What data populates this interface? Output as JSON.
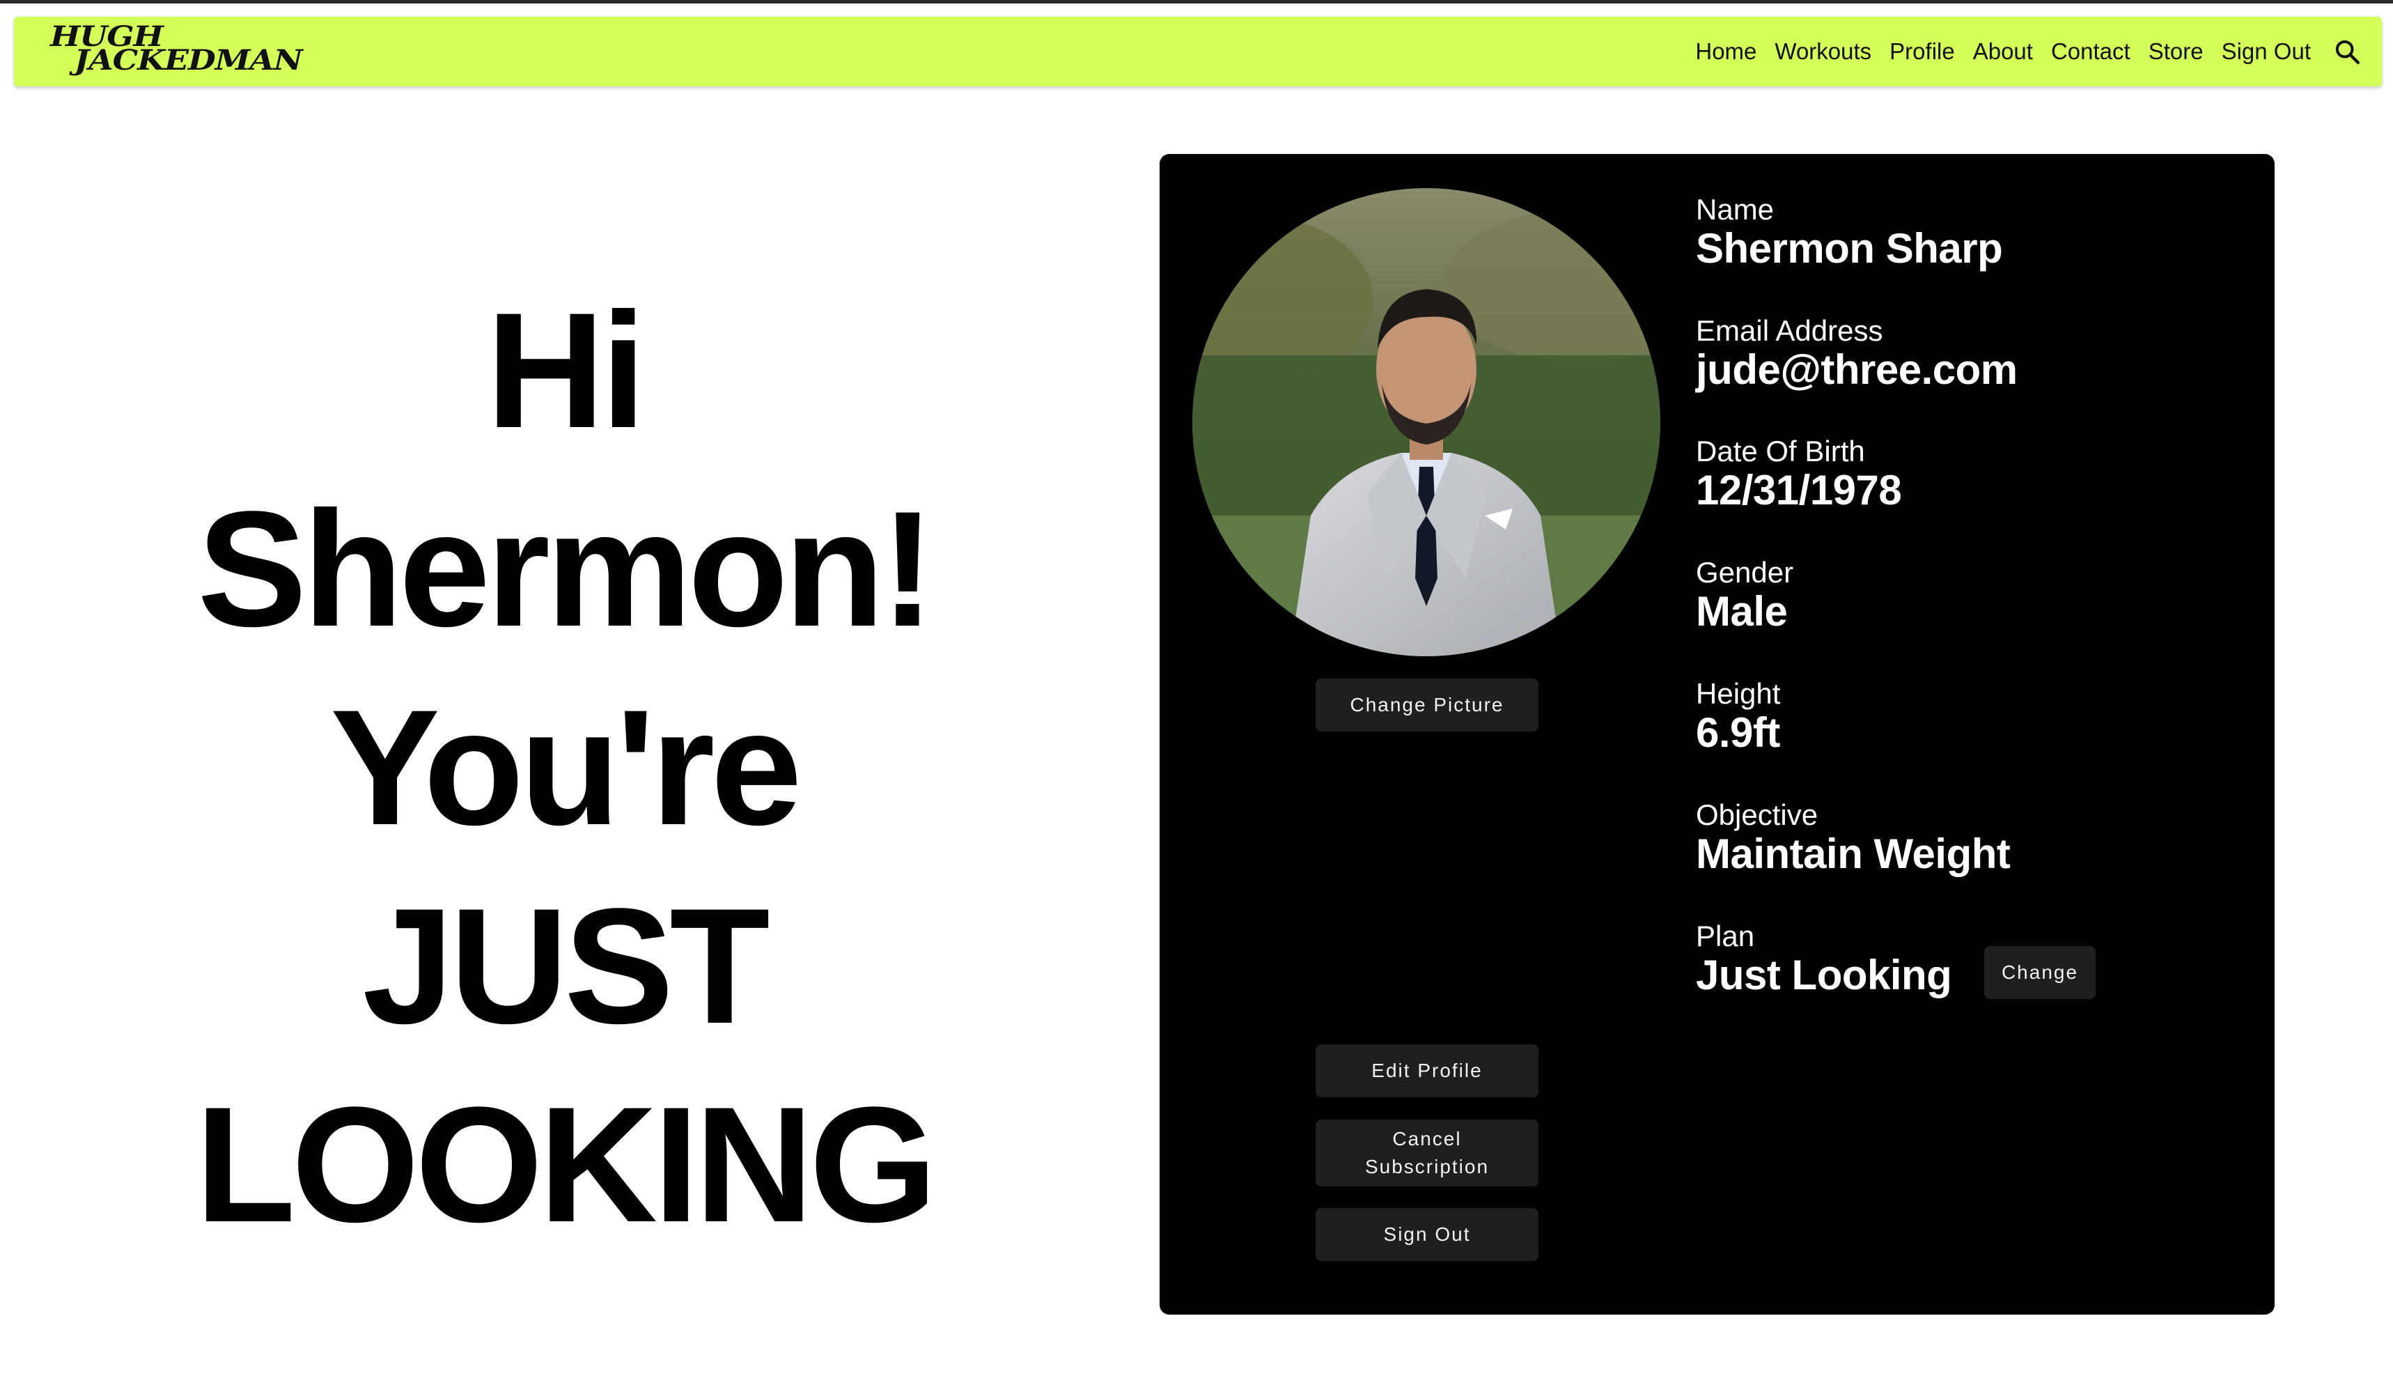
{
  "brand": {
    "logo_line1": "HUGH",
    "logo_line2": "JACKEDMAN"
  },
  "nav": {
    "items": [
      "Home",
      "Workouts",
      "Profile",
      "About",
      "Contact",
      "Store",
      "Sign Out"
    ],
    "search_icon": "search-icon"
  },
  "greeting": {
    "line1": "Hi",
    "line2": "Shermon!",
    "line3": "You're",
    "line4": "JUST",
    "line5": "LOOKING"
  },
  "profile": {
    "change_picture_label": "Change Picture",
    "fields": [
      {
        "label": "Name",
        "value": "Shermon Sharp"
      },
      {
        "label": "Email Address",
        "value": "jude@three.com"
      },
      {
        "label": "Date Of Birth",
        "value": "12/31/1978"
      },
      {
        "label": "Gender",
        "value": "Male"
      },
      {
        "label": "Height",
        "value": "6.9ft"
      },
      {
        "label": "Objective",
        "value": "Maintain Weight"
      },
      {
        "label": "Plan",
        "value": "Just Looking"
      }
    ],
    "plan_change_label": "Change",
    "actions": {
      "edit": "Edit Profile",
      "cancel_line1": "Cancel",
      "cancel_line2": "Subscription",
      "signout": "Sign Out"
    }
  },
  "colors": {
    "nav_bg": "#d4ff58",
    "card_bg": "#000000",
    "button_bg": "#1f1f1f"
  }
}
